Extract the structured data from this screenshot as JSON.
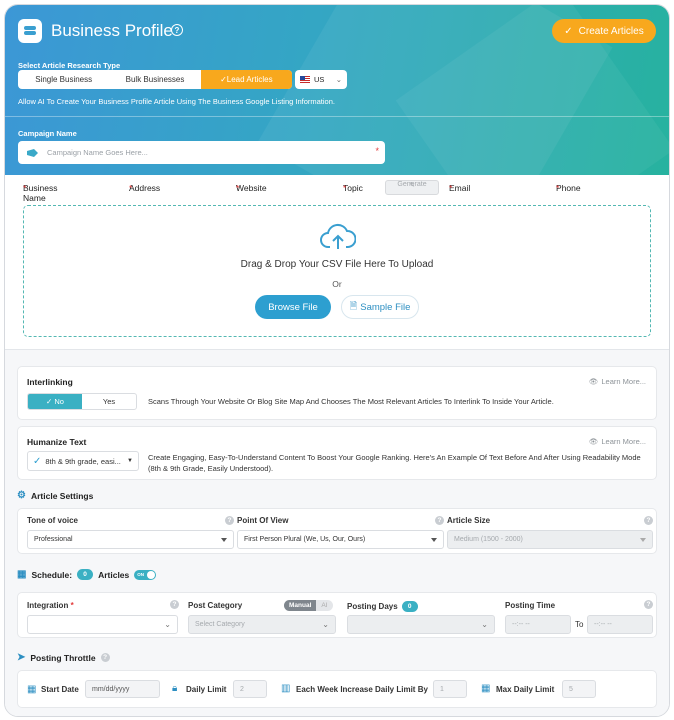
{
  "header": {
    "title": "Business Profile",
    "create_label": "Create Articles",
    "research_type_label": "Select Article Research Type",
    "research_types": [
      "Single Business",
      "Bulk Businesses",
      "Lead Articles"
    ],
    "country": "US",
    "description": "Allow AI To Create Your Business Profile Article Using The Business Google Listing Information.",
    "campaign_label": "Campaign Name",
    "campaign_placeholder": "Campaign Name Goes Here...",
    "required_mark": "*"
  },
  "columns": {
    "business_name": "Business Name",
    "address": "Address",
    "website": "Website",
    "topic": "Topic",
    "generate": "Generate",
    "email": "Email",
    "phone": "Phone"
  },
  "upload": {
    "title": "Drag & Drop Your CSV File Here To Upload",
    "or": "Or",
    "browse": "Browse File",
    "sample": "Sample File"
  },
  "interlinking": {
    "title": "Interlinking",
    "learn": "Learn More...",
    "no": "No",
    "yes": "Yes",
    "description": "Scans Through Your Website Or Blog Site Map And Chooses The Most Relevant Articles To Interlink To Inside Your Article."
  },
  "humanize": {
    "title": "Humanize Text",
    "learn": "Learn More...",
    "value": "8th & 9th grade, easi...",
    "description": "Create Engaging, Easy-To-Understand Content To Boost Your Google Ranking. Here's An Example Of Text Before And After Using Readability Mode (8th & 9th Grade, Easily Understood)."
  },
  "article_settings": {
    "title": "Article Settings",
    "tone_label": "Tone of voice",
    "tone_value": "Professional",
    "pov_label": "Point Of View",
    "pov_value": "First Person Plural (We, Us, Our, Ours)",
    "size_label": "Article Size",
    "size_value": "Medium (1500 - 2000)"
  },
  "schedule": {
    "label": "Schedule:",
    "count": "0",
    "articles": "Articles",
    "switch": "ON",
    "integration_label": "Integration",
    "post_category_label": "Post Category",
    "manual": "Manual",
    "ai": "AI",
    "category_placeholder": "Select Category",
    "posting_days_label": "Posting Days",
    "posting_days_count": "0",
    "posting_time_label": "Posting Time",
    "time_from": "--:-- --",
    "to": "To",
    "time_to": "--:-- --"
  },
  "throttle": {
    "title": "Posting Throttle",
    "start_date": "Start Date",
    "date_placeholder": "mm/dd/yyyy",
    "daily_limit": "Daily Limit",
    "daily_limit_value": "2",
    "weekly_increase": "Each Week Increase Daily Limit By",
    "weekly_increase_value": "1",
    "max_daily": "Max Daily Limit",
    "max_daily_value": "5"
  }
}
